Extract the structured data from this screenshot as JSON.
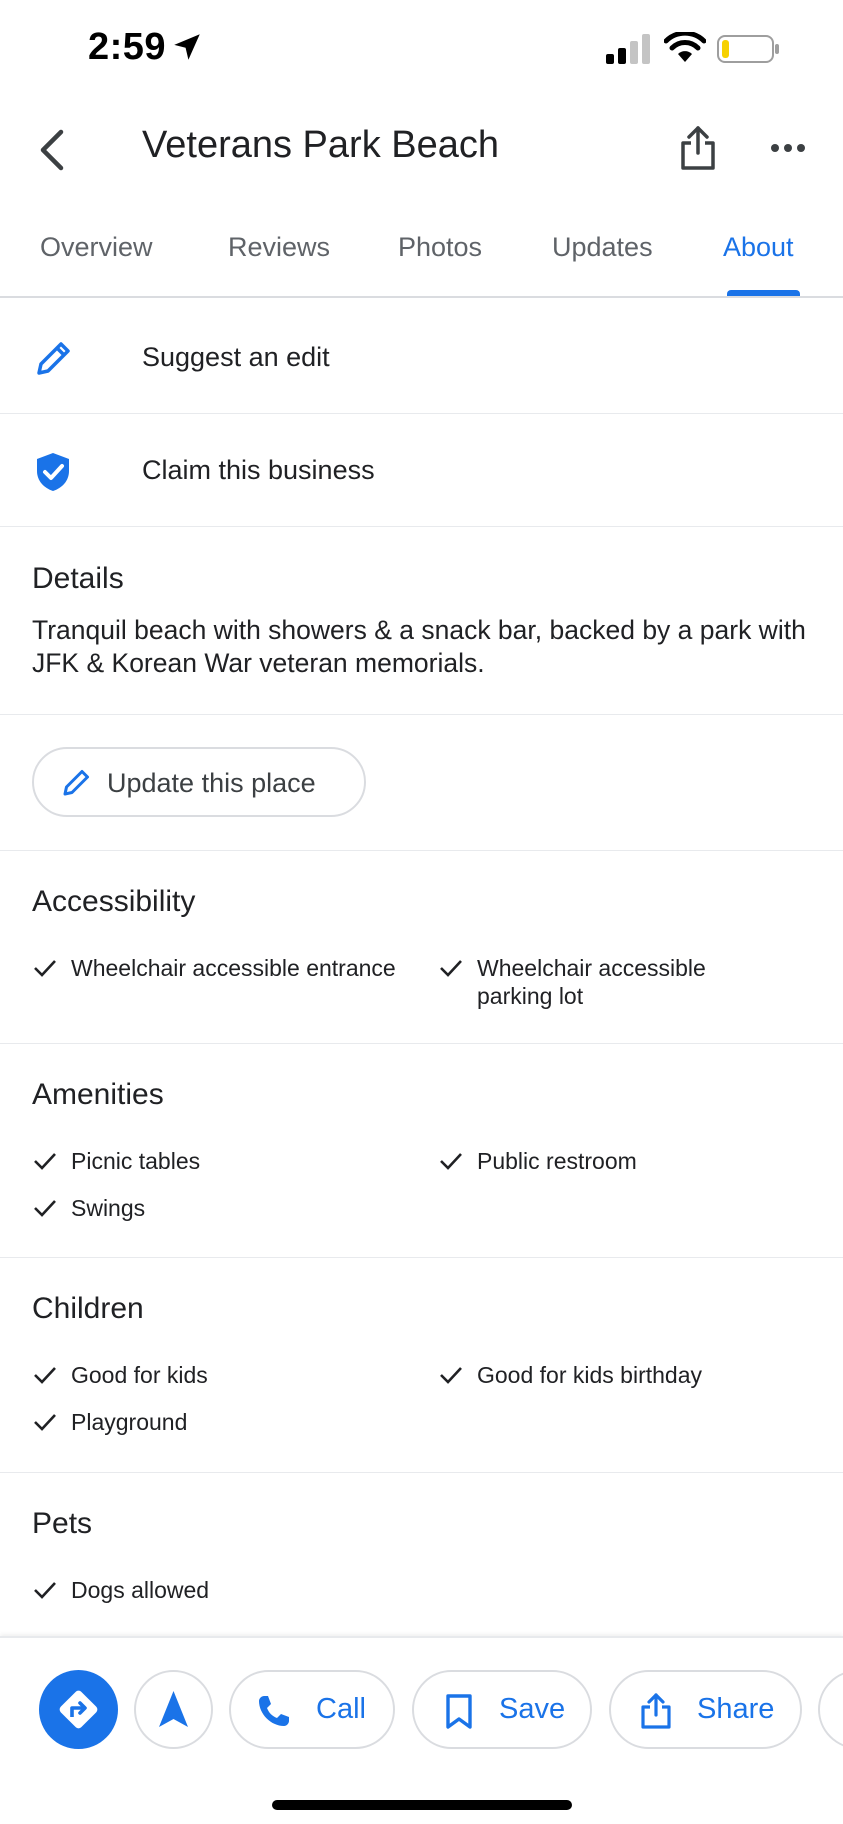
{
  "status_bar": {
    "time": "2:59"
  },
  "header": {
    "title": "Veterans Park Beach"
  },
  "tabs": [
    {
      "label": "Overview"
    },
    {
      "label": "Reviews"
    },
    {
      "label": "Photos"
    },
    {
      "label": "Updates"
    },
    {
      "label": "About",
      "active": true
    }
  ],
  "actions": {
    "suggest_edit": "Suggest an edit",
    "claim_business": "Claim this business"
  },
  "details": {
    "title": "Details",
    "description": "Tranquil beach with showers & a snack bar, backed by a park with JFK & Korean War veteran memorials."
  },
  "update_place": {
    "label": "Update this place"
  },
  "accessibility": {
    "title": "Accessibility",
    "items": [
      "Wheelchair accessible entrance",
      "Wheelchair accessible parking lot"
    ]
  },
  "amenities": {
    "title": "Amenities",
    "items": [
      "Picnic tables",
      "Public restroom",
      "Swings"
    ]
  },
  "children": {
    "title": "Children",
    "items": [
      "Good for kids",
      "Good for kids birthday",
      "Playground"
    ]
  },
  "pets": {
    "title": "Pets",
    "items": [
      "Dogs allowed"
    ]
  },
  "bottom_bar": {
    "call": "Call",
    "save": "Save",
    "share": "Share"
  },
  "colors": {
    "accent": "#1a73e8",
    "text": "#202124",
    "divider": "#e8eaed",
    "battery_low": "#f6d100"
  },
  "battery_level": 0.15
}
